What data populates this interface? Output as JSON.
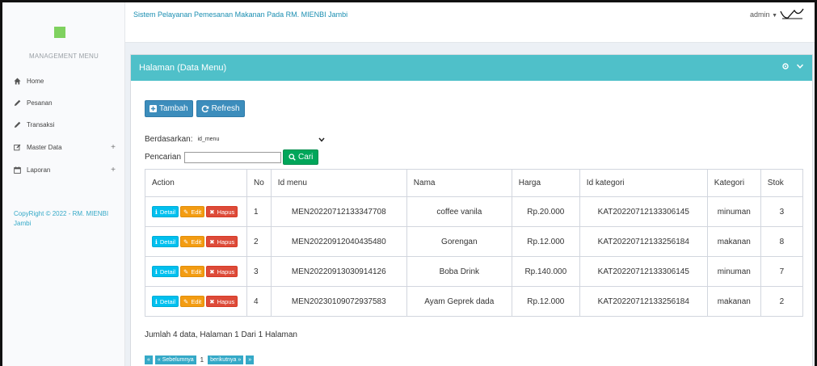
{
  "app": {
    "title": "Sistem Pelayanan Pemesanan Makanan Pada RM. MIENBI Jambi",
    "user": "admin"
  },
  "colors": {
    "accent": "#4fc0c9",
    "primary": "#3c8dbc",
    "success": "#00a65a",
    "info": "#00c0ef",
    "warning": "#f39c12",
    "danger": "#dd4b39",
    "logo": "#7fd15f"
  },
  "sidebar": {
    "heading": "MANAGEMENT MENU",
    "items": [
      {
        "label": "Home",
        "icon": "home-icon"
      },
      {
        "label": "Pesanan",
        "icon": "pencil-icon"
      },
      {
        "label": "Transaksi",
        "icon": "pencil-icon"
      },
      {
        "label": "Master Data",
        "icon": "edit-icon",
        "expand": "+"
      },
      {
        "label": "Laporan",
        "icon": "calendar-icon",
        "expand": "+"
      }
    ],
    "copyright": "CopyRight © 2022 - RM. MIENBI Jambi"
  },
  "box": {
    "title": "Halaman (Data Menu)"
  },
  "toolbar": {
    "add_label": "Tambah",
    "refresh_label": "Refresh"
  },
  "filter": {
    "label": "Berdasarkan:",
    "selected": "id_menu"
  },
  "search": {
    "label": "Pencarian",
    "value": "",
    "button_label": "Cari"
  },
  "table": {
    "headers": [
      "Action",
      "No",
      "Id menu",
      "Nama",
      "Harga",
      "Id kategori",
      "Kategori",
      "Stok"
    ],
    "action_labels": {
      "detail": "Detail",
      "edit": "Edit",
      "delete": "Hapus"
    },
    "rows": [
      {
        "no": "1",
        "id_menu": "MEN20220712133347708",
        "nama": "coffee vanila",
        "harga": "Rp.20.000",
        "id_kategori": "KAT20220712133306145",
        "kategori": "minuman",
        "stok": "3"
      },
      {
        "no": "2",
        "id_menu": "MEN20220912040435480",
        "nama": "Gorengan",
        "harga": "Rp.12.000",
        "id_kategori": "KAT20220712133256184",
        "kategori": "makanan",
        "stok": "8"
      },
      {
        "no": "3",
        "id_menu": "MEN20220913030914126",
        "nama": "Boba Drink",
        "harga": "Rp.140.000",
        "id_kategori": "KAT20220712133306145",
        "kategori": "minuman",
        "stok": "7"
      },
      {
        "no": "4",
        "id_menu": "MEN20230109072937583",
        "nama": "Ayam Geprek dada",
        "harga": "Rp.12.000",
        "id_kategori": "KAT20220712133256184",
        "kategori": "makanan",
        "stok": "2"
      }
    ]
  },
  "summary": "Jumlah 4 data, Halaman 1 Dari 1 Halaman",
  "pagination": {
    "first": "«",
    "prev": "« Sebelumnya",
    "current": "1",
    "next": "berikutnya »",
    "last": "»"
  }
}
